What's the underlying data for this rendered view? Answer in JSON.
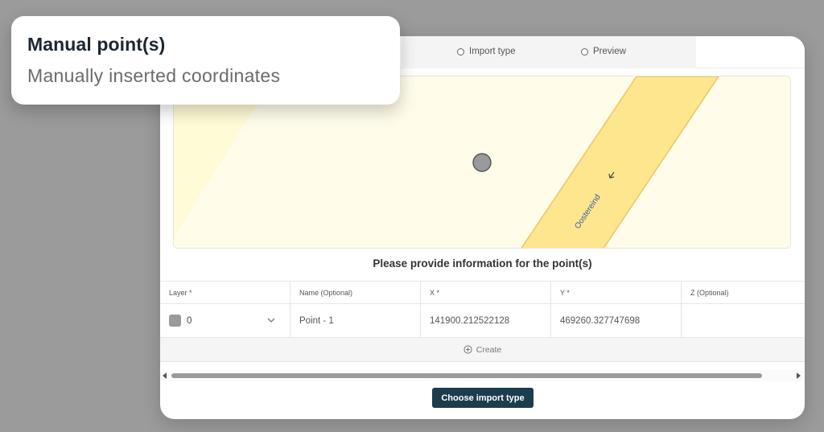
{
  "tooltip": {
    "title": "Manual point(s)",
    "subtitle": "Manually inserted coordinates"
  },
  "steps": [
    {
      "label": "Import type"
    },
    {
      "label": "Preview"
    }
  ],
  "map": {
    "street_label": "Oostereind",
    "colors": {
      "background": "#fffcea",
      "road": "#fde68e",
      "road_edge": "#e9c665",
      "marker": "#9a9a9a"
    }
  },
  "form": {
    "title": "Please provide information for the point(s)",
    "columns": [
      "Layer *",
      "Name (Optional)",
      "X *",
      "Y *",
      "Z (Optional)"
    ],
    "rows": [
      {
        "layer": "0",
        "name": "Point - 1",
        "x": "141900.212522128",
        "y": "469260.327747698",
        "z": ""
      }
    ],
    "create_label": "Create"
  },
  "footer": {
    "button_label": "Choose import type"
  },
  "colors": {
    "accent": "#1d3c4e",
    "page_bg": "#9b9b9b"
  }
}
